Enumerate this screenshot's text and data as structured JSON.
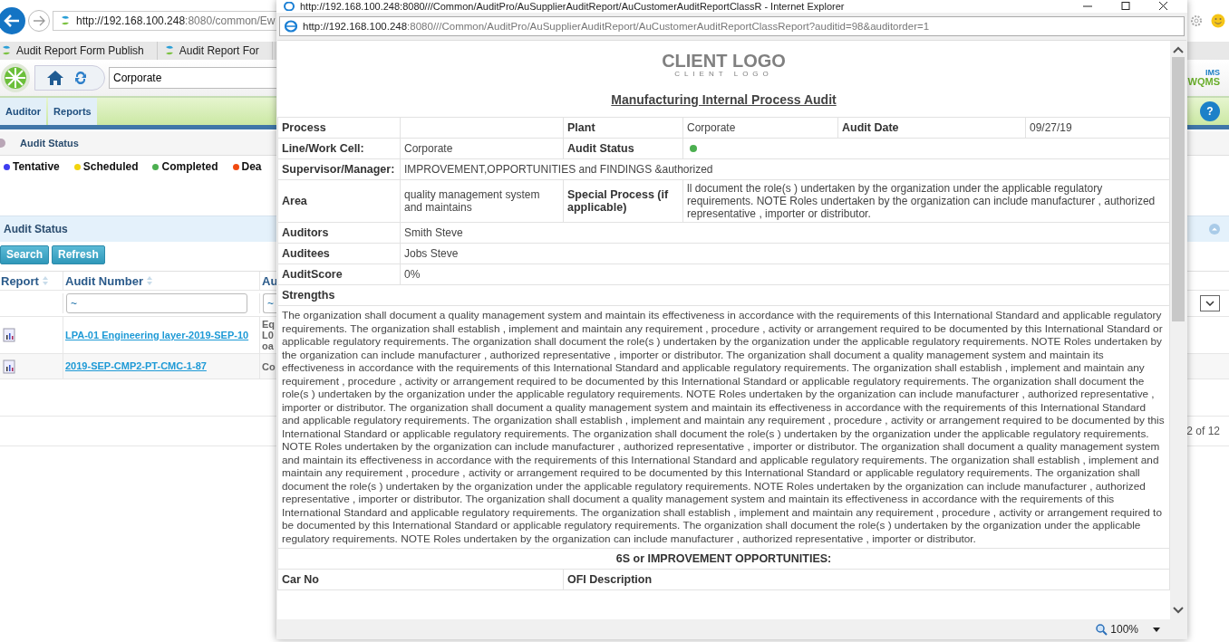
{
  "browser": {
    "url_host": "http://192.168.100.248",
    "url_rest": ":8080/common/Ew",
    "tabs": [
      "Audit Report Form Publish",
      "Audit Report For"
    ]
  },
  "app": {
    "site": "Corporate",
    "menu": [
      "Auditor",
      "Reports"
    ],
    "breadcrumb": "Audit Status",
    "logo_top": "IMS",
    "logo_main": "WQMS",
    "help": "?"
  },
  "legend": [
    {
      "label": "Tentative",
      "color": "#3d3df0"
    },
    {
      "label": "Scheduled",
      "color": "#f2d40c"
    },
    {
      "label": "Completed",
      "color": "#4caf50"
    },
    {
      "label": "Dea",
      "color": "#f04a10"
    }
  ],
  "panel": {
    "title": "Audit Status",
    "buttons": [
      "Search",
      "Refresh"
    ],
    "columns": [
      "Report",
      "Audit Number",
      "Au"
    ],
    "filters": [
      "~",
      "~"
    ],
    "rows": [
      {
        "number": "LPA-01 Engineering layer-2019-SEP-10",
        "column_3": [
          "Eq",
          "L0",
          "oa"
        ]
      },
      {
        "number": "2019-SEP-CMP2-PT-CMC-1-87",
        "column_3": [
          "Co"
        ]
      }
    ],
    "pager": "2 of 12"
  },
  "popup": {
    "title": "http://192.168.100.248:8080///Common/AuditPro/AuSupplierAuditReport/AuCustomerAuditReportClassR - Internet Explorer",
    "url_host": "http://192.168.100.248",
    "url_rest": ":8080///Common/AuditPro/AuSupplierAuditReport/AuCustomerAuditReportClassReport?auditid=98&auditorder=1",
    "zoom": "100%"
  },
  "report": {
    "logo_main": "CLIENT LOGO",
    "logo_sub": "CLIENT LOGO",
    "title": "Manufacturing Internal Process Audit",
    "header_row": [
      {
        "label": "Process"
      },
      {
        "label": "Plant",
        "value": "Corporate"
      },
      {
        "label": "Audit Date",
        "value": "09/27/19"
      }
    ],
    "line_cell": {
      "label": "Line/Work Cell:",
      "value": "Corporate"
    },
    "audit_status": {
      "label": "Audit Status",
      "color": "#4caf50"
    },
    "supervisor": {
      "label": "Supervisor/Manager:",
      "value": "IMPROVEMENT,OPPORTUNITIES and FINDINGS &authorized"
    },
    "area": {
      "label": "Area",
      "value": "quality management system and maintains"
    },
    "special_process": {
      "label": "Special Process (if applicable)",
      "value": "ll document the role(s ) undertaken by the organization under the applicable regulatory requirements. NOTE Roles undertaken by the organization can include manufacturer , authorized representative , importer or distributor."
    },
    "people": [
      {
        "label": "Auditors",
        "value": "Smith Steve"
      },
      {
        "label": "Auditees",
        "value": "Jobs Steve"
      },
      {
        "label": "AuditScore",
        "value": "0%"
      }
    ],
    "strengths": {
      "label": "Strengths",
      "text": "The organization shall document a quality management system and maintain its effectiveness in accordance with the requirements of this International Standard and applicable regulatory requirements. The organization shall establish , implement and maintain any requirement , procedure , activity or arrangement required to be documented by this International Standard or applicable regulatory requirements. The organization shall document the role(s ) undertaken by the organization under the applicable regulatory requirements. NOTE Roles undertaken by the organization can include manufacturer , authorized representative , importer or distributor. The organization shall document a quality management system and maintain its effectiveness in accordance with the requirements of this International Standard and applicable regulatory requirements. The organization shall establish , implement and maintain any requirement , procedure , activity or arrangement required to be documented by this International Standard or applicable regulatory requirements. The organization shall document the role(s ) undertaken by the organization under the applicable regulatory requirements. NOTE Roles undertaken by the organization can include manufacturer , authorized representative , importer or distributor. The organization shall document a quality management system and maintain its effectiveness in accordance with the requirements of this International Standard and applicable regulatory requirements. The organization shall establish , implement and maintain any requirement , procedure , activity or arrangement required to be documented by this International Standard or applicable regulatory requirements. The organization shall document the role(s ) undertaken by the organization under the applicable regulatory requirements. NOTE Roles undertaken by the organization can include manufacturer , authorized representative , importer or distributor. The organization shall document a quality management system and maintain its effectiveness in accordance with the requirements of this International Standard and applicable regulatory requirements. The organization shall establish , implement and maintain any requirement , procedure , activity or arrangement required to be documented by this International Standard or applicable regulatory requirements. The organization shall document the role(s ) undertaken by the organization under the applicable regulatory requirements. NOTE Roles undertaken by the organization can include manufacturer , authorized representative , importer or distributor. The organization shall document a quality management system and maintain its effectiveness in accordance with the requirements of this International Standard and applicable regulatory requirements. The organization shall establish , implement and maintain any requirement , procedure , activity or arrangement required to be documented by this International Standard or applicable regulatory requirements. The organization shall document the role(s ) undertaken by the organization under the applicable regulatory requirements. NOTE Roles undertaken by the organization can include manufacturer , authorized representative , importer or distributor."
    },
    "ofi": {
      "heading": "6S or IMPROVEMENT OPPORTUNITIES:",
      "columns": [
        "Car No",
        "OFI Description"
      ]
    }
  }
}
